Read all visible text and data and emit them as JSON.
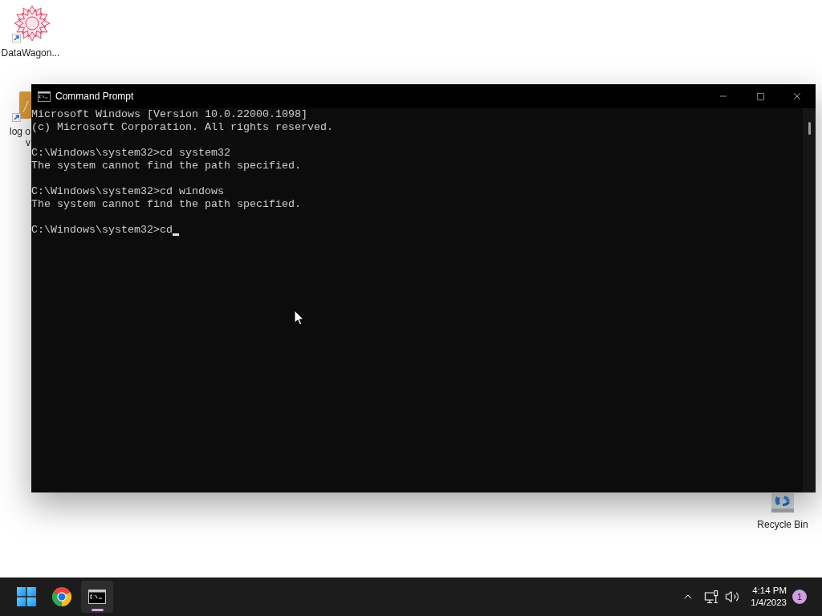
{
  "desktop": {
    "icons": [
      {
        "kind": "star-app",
        "lines": [
          "DataWagon..."
        ]
      },
      {
        "kind": "document",
        "lines": [
          "log o",
          "v"
        ]
      },
      {
        "kind": "recycle-bin",
        "lines": [
          "Recycle Bin"
        ]
      }
    ]
  },
  "window": {
    "title": "Command Prompt",
    "blocks": [
      [
        "Microsoft Windows [Version 10.0.22000.1098]",
        "(c) Microsoft Corporation. All rights reserved."
      ],
      [
        "C:\\Windows\\system32>cd system32",
        "The system cannot find the path specified."
      ],
      [
        "C:\\Windows\\system32>cd windows",
        "The system cannot find the path specified."
      ],
      [
        "C:\\Windows\\system32>cd"
      ]
    ],
    "cursor": true
  },
  "taskbar": {
    "apps": [
      {
        "kind": "start",
        "selected": false
      },
      {
        "kind": "browser",
        "selected": false
      },
      {
        "kind": "terminal",
        "selected": true
      }
    ],
    "tray": {
      "time": "4:14 PM",
      "date": "1/4/2023",
      "notification_count": "1"
    }
  }
}
